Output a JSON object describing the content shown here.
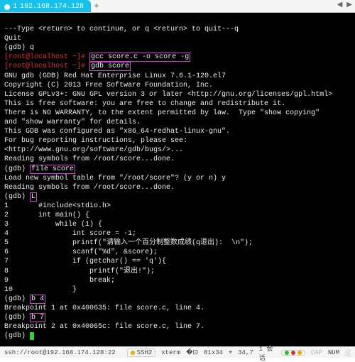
{
  "tab": {
    "index": "1",
    "title": "192.168.174.128"
  },
  "tabbar": {
    "add": "+",
    "left": "◀",
    "right": "▶"
  },
  "term": {
    "typehint": "---Type <return> to continue, or q <return> to quit---q",
    "quit": "Quit",
    "gdb_q": "(gdb) q",
    "prompt1_user": "[root@localhost ~]#",
    "cmd1": "gcc score.c -o score -g",
    "prompt2_user": "[root@localhost ~]#",
    "cmd2": "gdb score",
    "gnu1": "GNU gdb (GDB) Red Hat Enterprise Linux 7.6.1-120.el7",
    "gnu2": "Copyright (C) 2013 Free Software Foundation, Inc.",
    "gnu3": "License GPLv3+: GNU GPL version 3 or later <http://gnu.org/licenses/gpl.html>",
    "gnu4": "This is free software: you are free to change and redistribute it.",
    "gnu5": "There is NO WARRANTY, to the extent permitted by law.  Type \"show copying\"",
    "gnu6": "and \"show warranty\" for details.",
    "gnu7": "This GDB was configured as \"x86_64-redhat-linux-gnu\".",
    "gnu8": "For bug reporting instructions, please see:",
    "gnu9": "<http://www.gnu.org/software/gdb/bugs/>...",
    "read1": "Reading symbols from /root/score...done.",
    "gdb_file_prompt": "(gdb)",
    "gdb_file_cmd": "file score",
    "load": "Load new symbol table from \"/root/score\"? (y or n) y",
    "read2": "Reading symbols from /root/score...done.",
    "gdb_l_prompt": "(gdb)",
    "gdb_l_cmd": "L",
    "src": {
      "l1": "1       #include<stdio.h>",
      "l2": "2       int main() {",
      "l3": "3           while (1) {",
      "l4": "4               int score = -1;",
      "l5": "5               printf(\"请输入一个百分制整数成绩(q退出):  \\n\");",
      "l6": "6               scanf(\"%d\", &score);",
      "l7": "7               if (getchar() == 'q'){",
      "l8": "8                   printf(\"退出!\");",
      "l9": "9                   break;",
      "l10": "10              }"
    },
    "gdb_b4_prompt": "(gdb)",
    "gdb_b4_cmd": "b 4",
    "bp1": "Breakpoint 1 at 0x400635: file score.c, line 4.",
    "gdb_b7_prompt": "(gdb)",
    "gdb_b7_cmd": "b 7",
    "bp2": "Breakpoint 2 at 0x40065c: file score.c, line 7.",
    "gdb_last": "(gdb) "
  },
  "status": {
    "conn": "ssh://root@192.168.174.128:22",
    "ssh": "SSH2",
    "term": "xterm",
    "size": "81x34",
    "pos": "34,7",
    "sess": "1 会话",
    "cap": "CAP",
    "num": "NUM"
  }
}
